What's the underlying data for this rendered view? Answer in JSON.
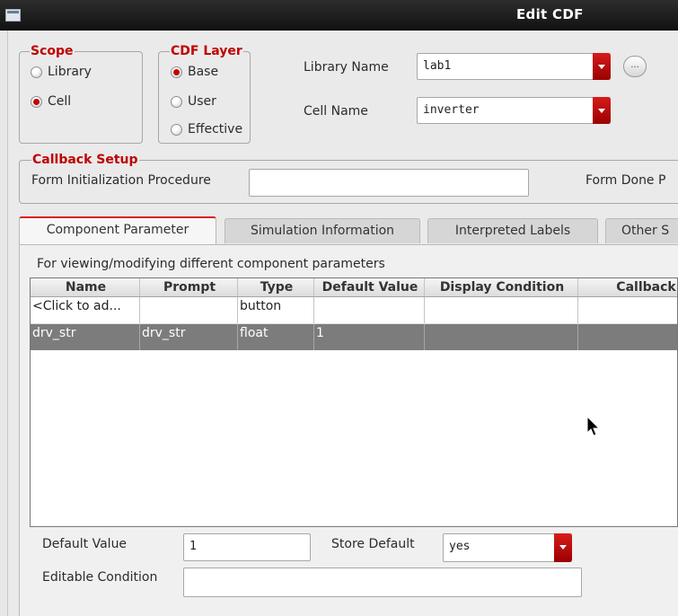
{
  "window": {
    "title": "Edit CDF"
  },
  "scope": {
    "legend": "Scope",
    "options": [
      "Library",
      "Cell"
    ],
    "selected": "Cell"
  },
  "cdf_layer": {
    "legend": "CDF Layer",
    "options": [
      "Base",
      "User",
      "Effective"
    ],
    "selected": "Base"
  },
  "library": {
    "label": "Library Name",
    "value": "lab1",
    "browse_label": "..."
  },
  "cell": {
    "label": "Cell Name",
    "value": "inverter"
  },
  "callback": {
    "legend": "Callback Setup",
    "form_init_label": "Form Initialization Procedure",
    "form_init_value": "",
    "form_done_label": "Form Done P"
  },
  "tabs": [
    {
      "label": "Component Parameter",
      "active": true
    },
    {
      "label": "Simulation Information",
      "active": false
    },
    {
      "label": "Interpreted Labels",
      "active": false
    },
    {
      "label": "Other S",
      "active": false
    }
  ],
  "component": {
    "description": "For viewing/modifying different component parameters",
    "columns": [
      "Name",
      "Prompt",
      "Type",
      "Default Value",
      "Display Condition",
      "Callback"
    ],
    "rows": [
      [
        "<Click to ad...",
        "",
        "button",
        "",
        "",
        ""
      ],
      [
        "drv_str",
        "drv_str",
        "float",
        "1",
        "",
        ""
      ]
    ],
    "selected_row": 1
  },
  "details": {
    "default_value_label": "Default Value",
    "default_value": "1",
    "store_default_label": "Store Default",
    "store_default": "yes",
    "editable_condition_label": "Editable Condition",
    "editable_condition": ""
  },
  "colors": {
    "accent_red": "#c40000",
    "selected_row": "#7c7c7c"
  }
}
